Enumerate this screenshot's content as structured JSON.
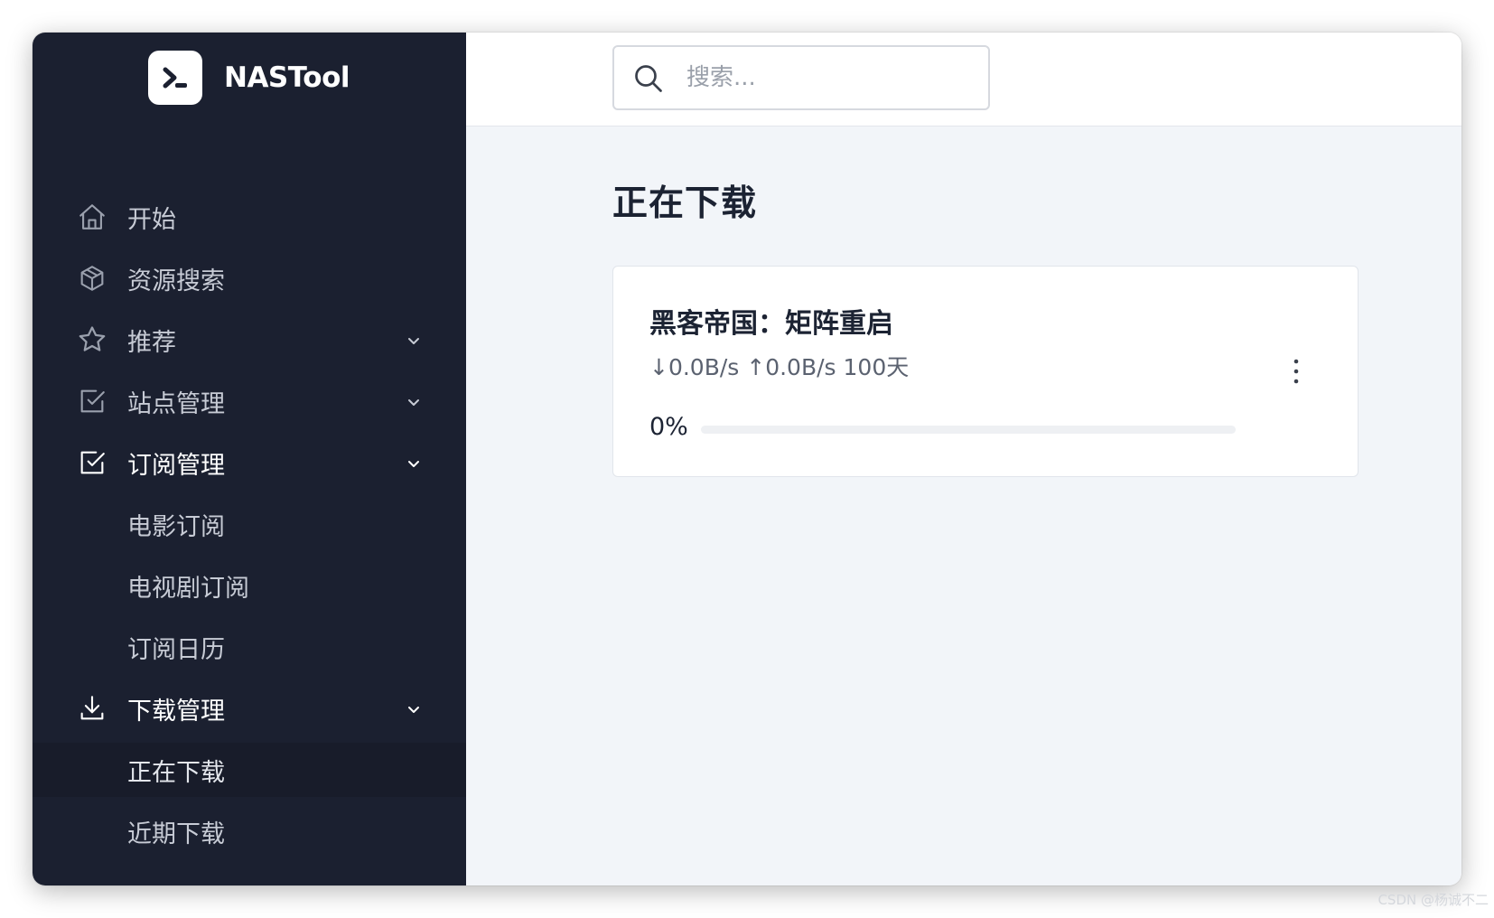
{
  "brand": {
    "name": "NASTool"
  },
  "search": {
    "placeholder": "搜索..."
  },
  "sidebar": {
    "items": [
      {
        "label": "开始",
        "icon": "home-icon"
      },
      {
        "label": "资源搜索",
        "icon": "cube-icon"
      },
      {
        "label": "推荐",
        "icon": "star-icon",
        "has_submenu": true
      },
      {
        "label": "站点管理",
        "icon": "checkbox-icon",
        "has_submenu": true
      },
      {
        "label": "订阅管理",
        "icon": "checkbox-icon",
        "has_submenu": true,
        "expanded": true,
        "children": [
          {
            "label": "电影订阅"
          },
          {
            "label": "电视剧订阅"
          },
          {
            "label": "订阅日历"
          }
        ]
      },
      {
        "label": "下载管理",
        "icon": "download-icon",
        "has_submenu": true,
        "expanded": true,
        "children": [
          {
            "label": "正在下载",
            "active": true
          },
          {
            "label": "近期下载"
          }
        ]
      }
    ]
  },
  "main": {
    "title": "正在下载",
    "downloads": [
      {
        "title": "黑客帝国：矩阵重启",
        "stats": "↓0.0B/s ↑0.0B/s 100天",
        "progress_label": "0%",
        "progress": 0
      }
    ]
  },
  "watermark": "CSDN @杨诚不二"
}
